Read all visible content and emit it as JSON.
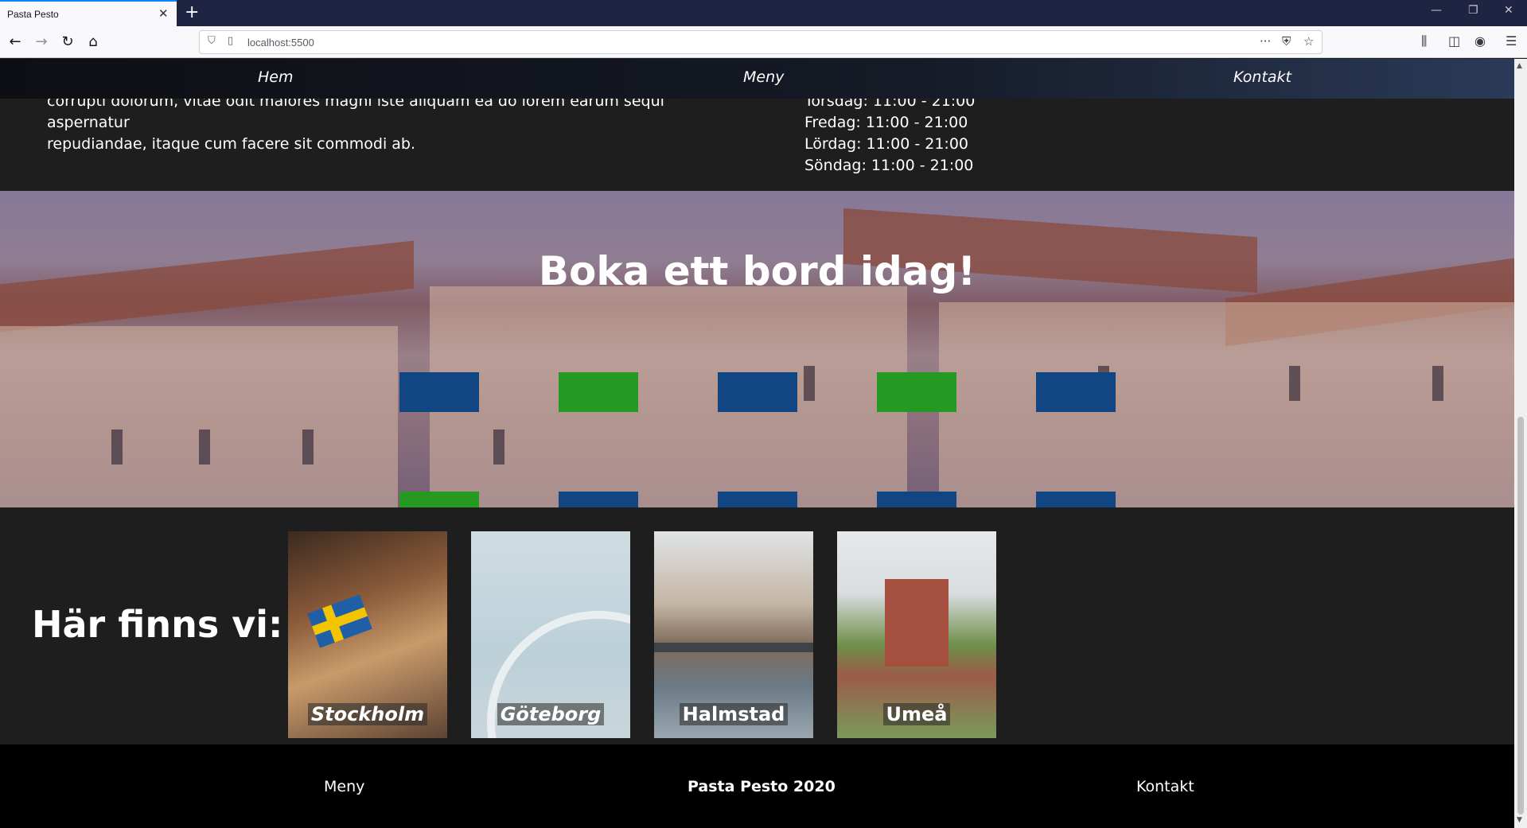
{
  "browser": {
    "tab_title": "Pasta Pesto",
    "url": "localhost:5500"
  },
  "nav": {
    "items": [
      "Hem",
      "Meny",
      "Kontakt"
    ]
  },
  "info": {
    "about_lines": [
      "corrupti dolorum, vitae odit maiores magni iste aliquam ea do lorem earum sequi aspernatur",
      "repudiandae, itaque cum facere sit commodi ab."
    ],
    "hours": [
      "Torsdag: 11:00 - 21:00",
      "Fredag: 11:00 - 21:00",
      "Lördag: 11:00 - 21:00",
      "Söndag: 11:00 - 21:00"
    ]
  },
  "booking": {
    "title": "Boka ett bord idag!",
    "tables": [
      {
        "status": "free"
      },
      {
        "status": "taken"
      },
      {
        "status": "free"
      },
      {
        "status": "taken"
      },
      {
        "status": "free"
      },
      {
        "status": "taken"
      },
      {
        "status": "free"
      },
      {
        "status": "free"
      },
      {
        "status": "free"
      },
      {
        "status": "free"
      }
    ],
    "colors": {
      "free": "#114682",
      "taken": "#269922"
    }
  },
  "locations": {
    "title": "Här finns vi:",
    "cities": [
      "Stockholm",
      "Göteborg",
      "Halmstad",
      "Umeå"
    ]
  },
  "footer": {
    "menu": "Meny",
    "brand": "Pasta Pesto 2020",
    "contact": "Kontakt"
  }
}
